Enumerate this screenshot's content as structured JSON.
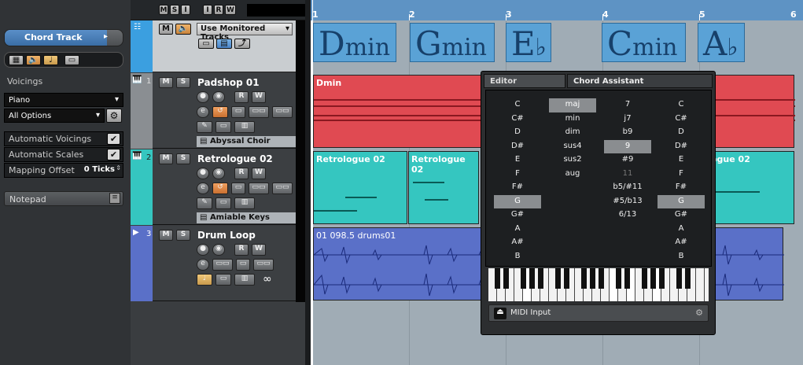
{
  "top_toolbar": {
    "m": "M",
    "s": "S",
    "r": "R",
    "w": "W"
  },
  "inspector": {
    "chord_track_label": "Chord Track",
    "voicings_label": "Voicings",
    "instrument_select": "Piano",
    "options_select": "All Options",
    "automatic_voicings": "Automatic Voicings",
    "automatic_scales": "Automatic Scales",
    "mapping_offset_label": "Mapping Offset",
    "mapping_offset_value": "0 Ticks",
    "notepad_label": "Notepad"
  },
  "chord_track_header": {
    "monitor_select": "Use Monitored Tracks",
    "m": "M"
  },
  "tracks": [
    {
      "number": "1",
      "name": "Padshop 01",
      "instrument": "Abyssal Choir",
      "color": "#e04a52"
    },
    {
      "number": "2",
      "name": "Retrologue 02",
      "instrument": "Amiable Keys",
      "color": "#35c6c0"
    },
    {
      "number": "3",
      "name": "Drum Loop",
      "color": "#5a70c8",
      "loop_symbol": "∞"
    }
  ],
  "ruler": {
    "bars": [
      "1",
      "2",
      "3",
      "4",
      "5",
      "6"
    ]
  },
  "chord_events": [
    {
      "root": "D",
      "quality": "min"
    },
    {
      "root": "G",
      "quality": "min"
    },
    {
      "root": "E",
      "quality": "♭"
    },
    {
      "root": "C",
      "quality": "min"
    },
    {
      "root": "A",
      "quality": "♭"
    }
  ],
  "parts": {
    "pad": "Dmin",
    "retro_a": "Retrologue 02",
    "retro_b": "Retrologue 02",
    "retro_c": "ogue 02",
    "drums": "01 098.5 drums01"
  },
  "popup": {
    "tab_editor": "Editor",
    "tab_assistant": "Chord Assistant",
    "roots": [
      "C",
      "C#",
      "D",
      "D#",
      "E",
      "F",
      "F#",
      "G",
      "G#",
      "A",
      "A#",
      "B"
    ],
    "root_selected": "G",
    "qualities": [
      "maj",
      "min",
      "dim",
      "sus4",
      "sus2",
      "aug"
    ],
    "quality_selected": "maj",
    "tensions": [
      "7",
      "j7",
      "b9",
      "9",
      "#9",
      "11",
      "b5/#11",
      "#5/b13",
      "6/13"
    ],
    "tension_selected": "9",
    "tension_disabled": "11",
    "bass": [
      "C",
      "C#",
      "D",
      "D#",
      "E",
      "F",
      "F#",
      "G",
      "G#",
      "A",
      "A#",
      "B"
    ],
    "bass_selected": "G",
    "midi_input": "MIDI Input"
  },
  "colors": {
    "accent": "#5aa2d6",
    "pad": "#e04a52",
    "keys": "#35c6c0",
    "drums": "#5a70c8"
  }
}
